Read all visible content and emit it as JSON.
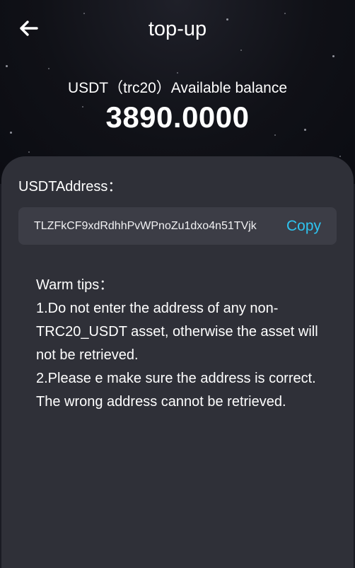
{
  "header": {
    "title": "top-up",
    "back_icon": "arrow-left-icon"
  },
  "balance": {
    "label": "USDT（trc20）Available balance",
    "value": "3890.0000"
  },
  "address": {
    "label": "USDTAddress：",
    "value": "TLZFkCF9xdRdhhPvWPnoZu1dxo4n51TVjk",
    "copy_label": "Copy"
  },
  "tips": {
    "heading": "Warm tips：",
    "line1": "1.Do not enter the address of any non-TRC20_USDT asset, otherwise the asset will not be retrieved.",
    "line2": "2.Please e make sure the address is correct. The wrong address cannot be retrieved."
  },
  "colors": {
    "accent": "#2ec4f0",
    "panel": "#2f3038",
    "address_box": "#3c3d46",
    "hero_bg": "#101117"
  }
}
